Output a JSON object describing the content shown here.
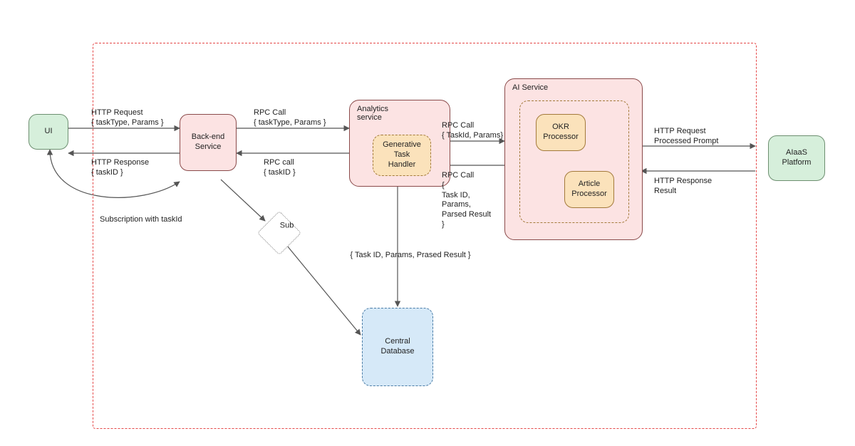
{
  "frame": {
    "boundary": "system boundary"
  },
  "nodes": {
    "ui": {
      "label": "UI"
    },
    "backend": {
      "label": "Back-end\nService"
    },
    "analytics": {
      "title": "Analytics\nservice"
    },
    "genHandler": {
      "label": "Generative\nTask\nHandler"
    },
    "aiService": {
      "title": "AI Service"
    },
    "okr": {
      "label": "OKR\nProcessor"
    },
    "article": {
      "label": "Article\nProcessor"
    },
    "aiaas": {
      "label": "AIaaS\nPlatform"
    },
    "sub": {
      "label": "Sub"
    },
    "db": {
      "label": "Central\nDatabase"
    }
  },
  "edges": {
    "ui_to_backend_req": "HTTP Request\n{ taskType, Params }",
    "backend_to_ui_resp": "HTTP Response\n{ taskID }",
    "backend_to_analytics_call": "RPC Call\n{ taskType, Params }",
    "analytics_to_backend_resp": "RPC call\n{ taskID }",
    "analytics_to_ai_call": "RPC Call\n{ TaskId, Params}",
    "ai_to_analytics_resp": "RPC Call\n{\nTask ID,\nParams,\nParsed Result\n}",
    "ai_to_aiaas_req": "HTTP Request\nProcessed Prompt",
    "aiaas_to_ai_resp": "HTTP Response\nResult",
    "subscription": "Subscription with taskId",
    "handler_to_db": "{ Task ID, Params, Prased Result }"
  }
}
